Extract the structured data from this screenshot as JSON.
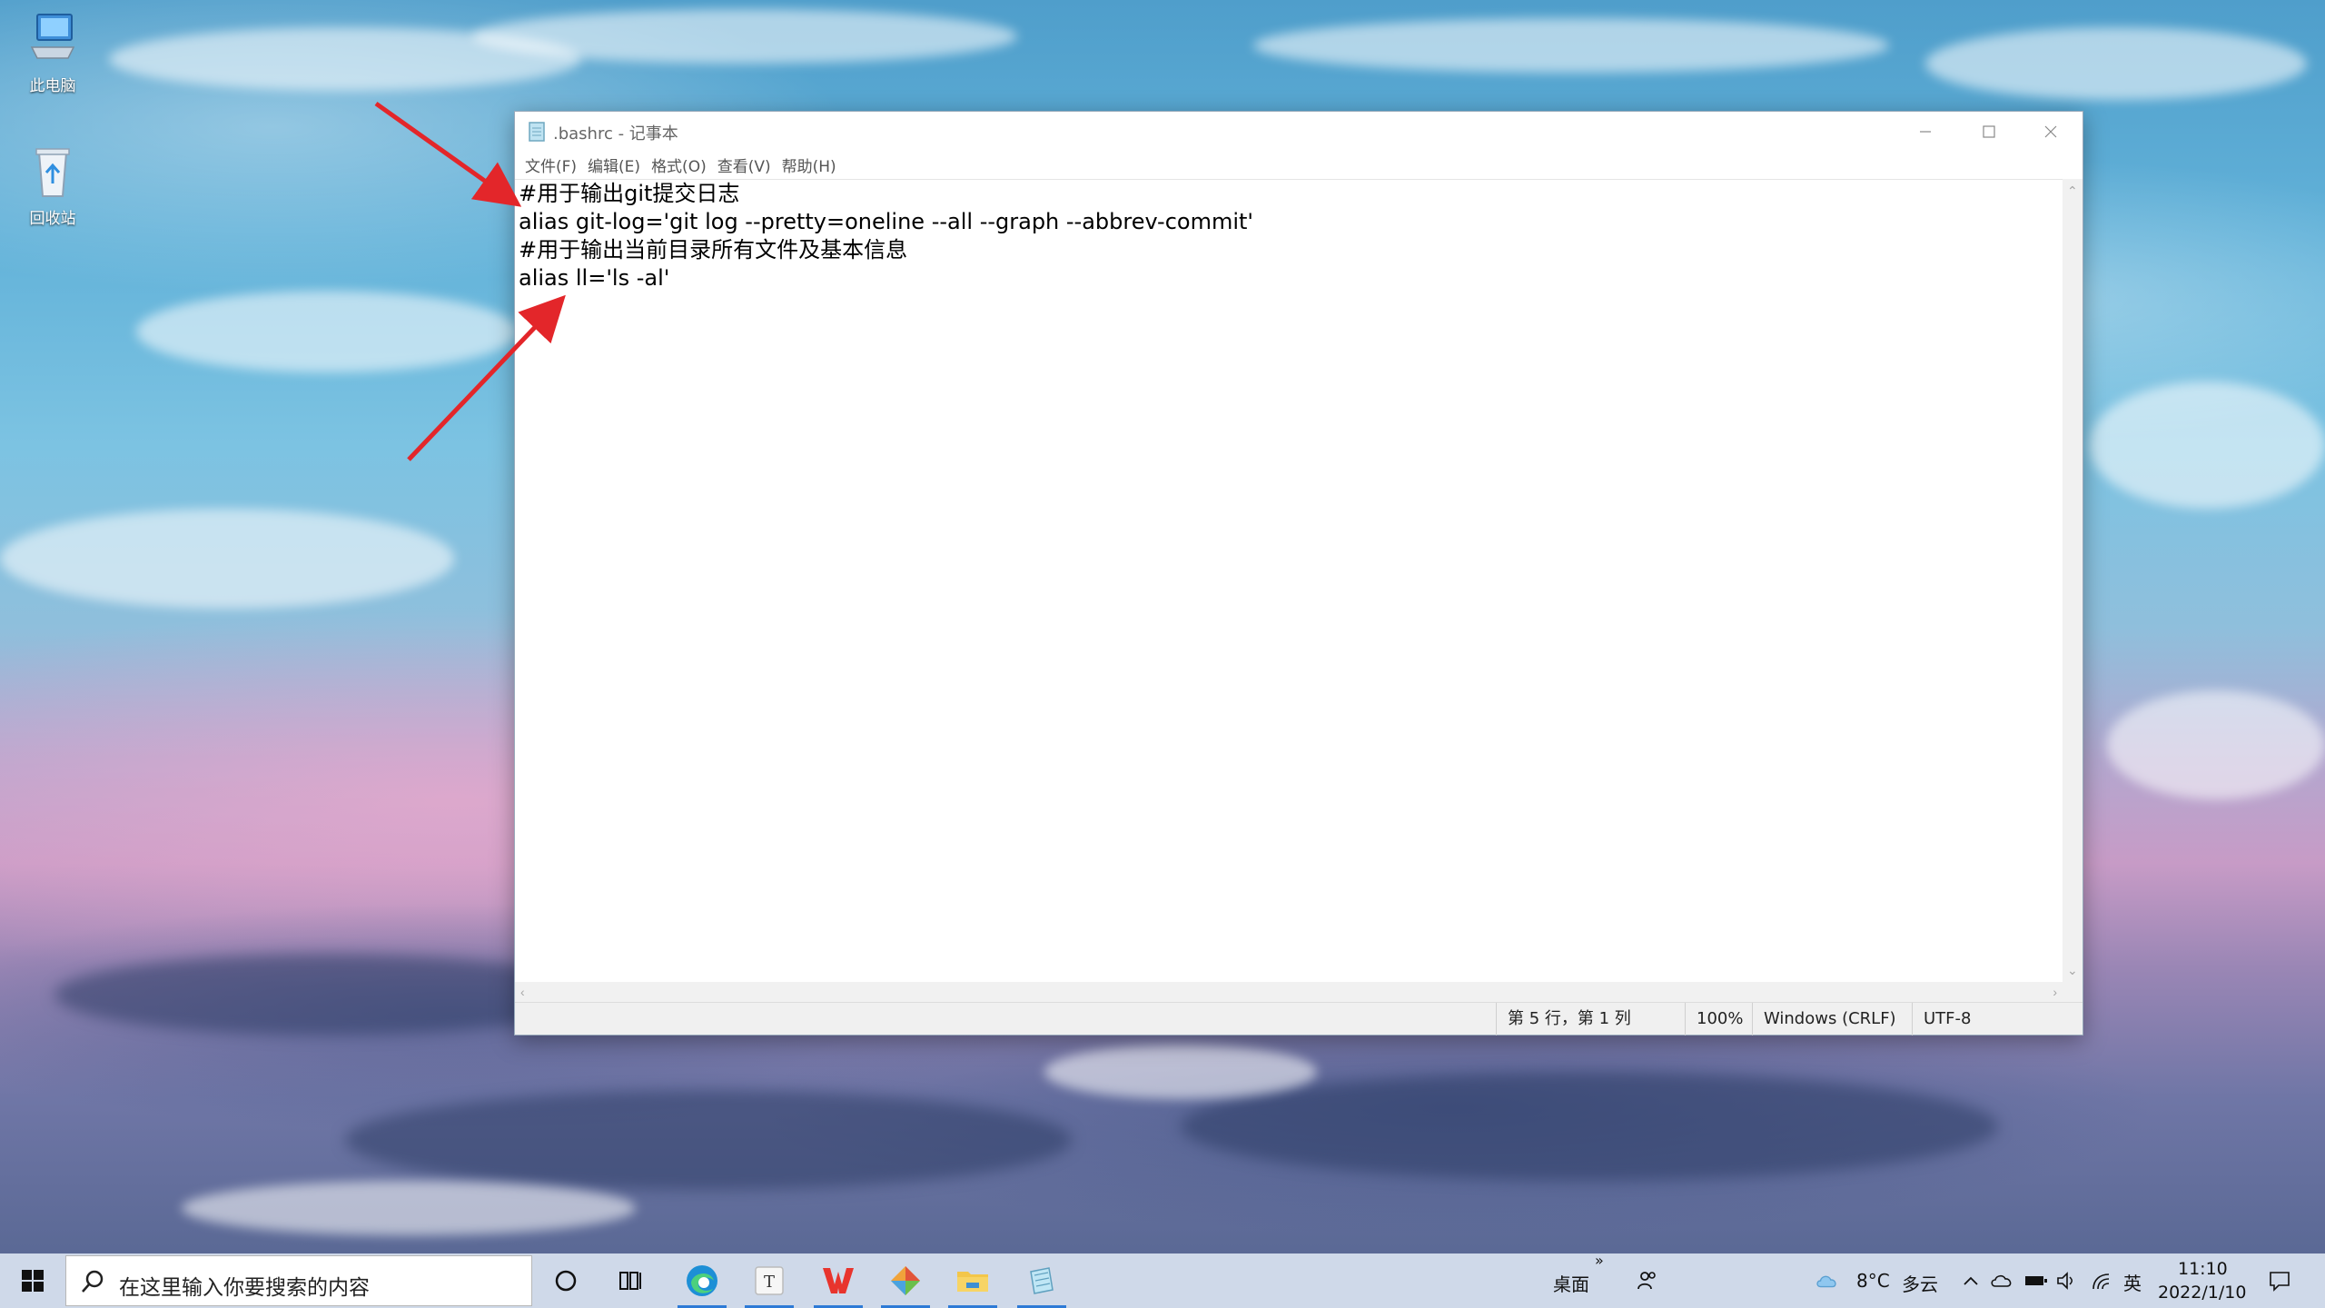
{
  "desktop": {
    "icons": [
      {
        "label": "此电脑",
        "icon": "computer-icon"
      },
      {
        "label": "回收站",
        "icon": "recycle-bin-icon"
      }
    ]
  },
  "window": {
    "title": ".bashrc - 记事本",
    "menu": [
      "文件(F)",
      "编辑(E)",
      "格式(O)",
      "查看(V)",
      "帮助(H)"
    ],
    "lines": [
      "#用于输出git提交日志",
      "alias git-log='git log --pretty=oneline --all --graph --abbrev-commit'",
      "#用于输出当前目录所有文件及基本信息",
      "alias ll='ls -al'"
    ],
    "status": {
      "position": "第 5 行，第 1 列",
      "zoom": "100%",
      "line_ending": "Windows (CRLF)",
      "encoding": "UTF-8"
    }
  },
  "taskbar": {
    "search_placeholder": "在这里输入你要搜索的内容",
    "apps": [
      "edge-icon",
      "typora-icon",
      "wps-icon",
      "git-icon",
      "file-explorer-icon",
      "notepad-icon"
    ],
    "desktop_label": "桌面",
    "chevron": "»",
    "weather": {
      "temp": "8°C",
      "condition": "多云"
    },
    "ime": "英",
    "time": "11:10",
    "date": "2022/1/10"
  },
  "colors": {
    "accent": "#2d7ad6",
    "annotation": "#e3262a"
  }
}
